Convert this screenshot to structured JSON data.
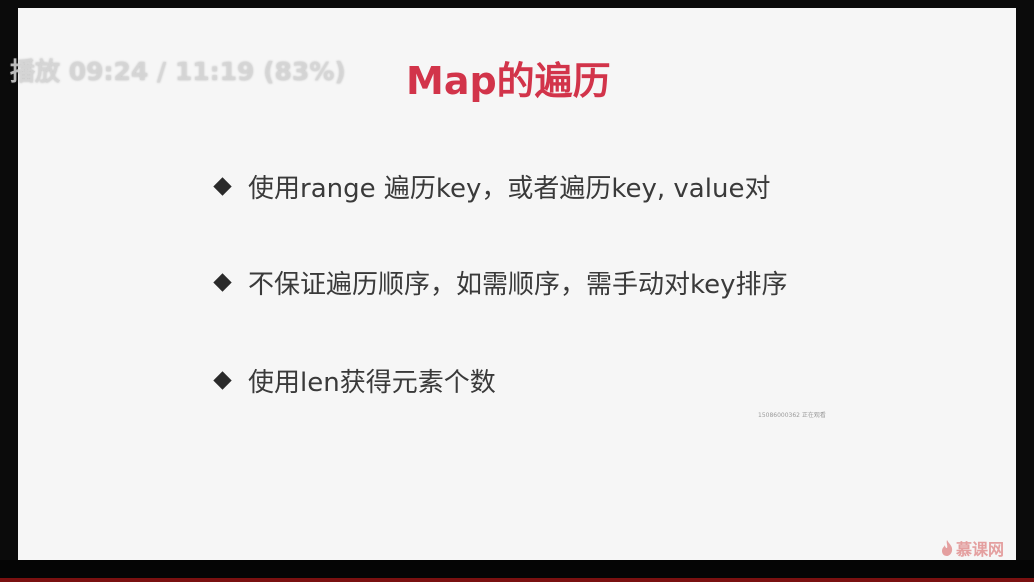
{
  "overlay": {
    "playback_text": "播放 09:24 / 11:19 (83%)"
  },
  "slide": {
    "title": "Map的遍历",
    "bullets": [
      "使用range 遍历key，或者遍历key, value对",
      "不保证遍历顺序，如需顺序，需手动对key排序",
      "使用len获得元素个数"
    ],
    "small_watermark": "15086000362 正在观看",
    "brand": "慕课网"
  },
  "colors": {
    "title": "#d2344a",
    "bullet_text": "#3a3a3a",
    "slide_bg": "#f6f6f6",
    "frame_bg": "#0b0b0b",
    "progress": "#7a1010"
  },
  "icons": {
    "bullet": "diamond-bullet-icon",
    "logo": "flame-logo-icon"
  },
  "playback": {
    "current": "09:24",
    "total": "11:19",
    "percent": 83
  }
}
